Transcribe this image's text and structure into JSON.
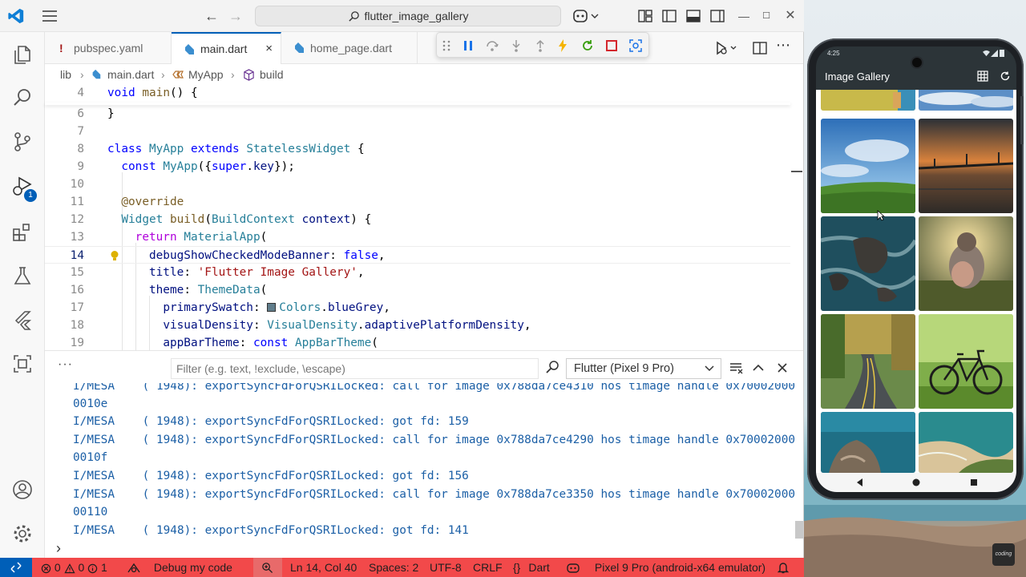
{
  "window": {
    "title": "flutter_image_gallery"
  },
  "activity_bar": {
    "debug_badge": "1"
  },
  "tabs": [
    {
      "label": "pubspec.yaml",
      "modified_marker": "!"
    },
    {
      "label": "main.dart",
      "close": "×"
    },
    {
      "label": "home_page.dart"
    }
  ],
  "breadcrumb": [
    "lib",
    "main.dart",
    "MyApp",
    "build"
  ],
  "code": {
    "lines": [
      {
        "num": "4",
        "text": "void main() {"
      },
      {
        "num": "6",
        "text": "}"
      },
      {
        "num": "7",
        "text": ""
      },
      {
        "num": "8",
        "text": "class MyApp extends StatelessWidget {"
      },
      {
        "num": "9",
        "text": "  const MyApp({super.key});"
      },
      {
        "num": "10",
        "text": ""
      },
      {
        "num": "11",
        "text": "  @override"
      },
      {
        "num": "12",
        "text": "  Widget build(BuildContext context) {"
      },
      {
        "num": "13",
        "text": "    return MaterialApp("
      },
      {
        "num": "14",
        "text": "      debugShowCheckedModeBanner: false,"
      },
      {
        "num": "15",
        "text": "      title: 'Flutter Image Gallery',"
      },
      {
        "num": "16",
        "text": "      theme: ThemeData("
      },
      {
        "num": "17",
        "text": "        primarySwatch: Colors.blueGrey,"
      },
      {
        "num": "18",
        "text": "        visualDensity: VisualDensity.adaptivePlatformDensity,"
      },
      {
        "num": "19",
        "text": "        appBarTheme: const AppBarTheme("
      }
    ],
    "swatch_color": "#607d8b"
  },
  "panel": {
    "filter_placeholder": "Filter (e.g. text, !exclude, \\escape)",
    "device_select": "Flutter (Pixel 9 Pro)",
    "log_lines": [
      "0010e",
      "I/MESA    ( 1948): exportSyncFdForQSRILocked: got fd: 159",
      "I/MESA    ( 1948): exportSyncFdForQSRILocked: call for image 0x788da7ce4290 hos timage handle 0x70002000",
      "0010f",
      "I/MESA    ( 1948): exportSyncFdForQSRILocked: got fd: 156",
      "I/MESA    ( 1948): exportSyncFdForQSRILocked: call for image 0x788da7ce3350 hos timage handle 0x70002000",
      "00110",
      "I/MESA    ( 1948): exportSyncFdForQSRILocked: got fd: 141"
    ],
    "top_partial_line": "I/MESA    ( 1948): exportSyncFdForQSRILocked: call for image 0x788da7ce4310 hos timage handle 0x70002000",
    "prompt": "›"
  },
  "statusbar": {
    "errors": "0",
    "warnings": "0",
    "info": "1",
    "debug_label": "Debug my code",
    "position": "Ln 14, Col 40",
    "spaces": "Spaces: 2",
    "encoding": "UTF-8",
    "eol": "CRLF",
    "language": "Dart",
    "device": "Pixel 9 Pro (android-x64 emulator)",
    "language_braces": "{}"
  },
  "phone": {
    "time": "4:25",
    "app_title": "Image Gallery",
    "watermark": "coding"
  },
  "colors": {
    "accent": "#005fb8",
    "statusbar_debug": "#f2494a",
    "appbar": "#2c3438"
  }
}
